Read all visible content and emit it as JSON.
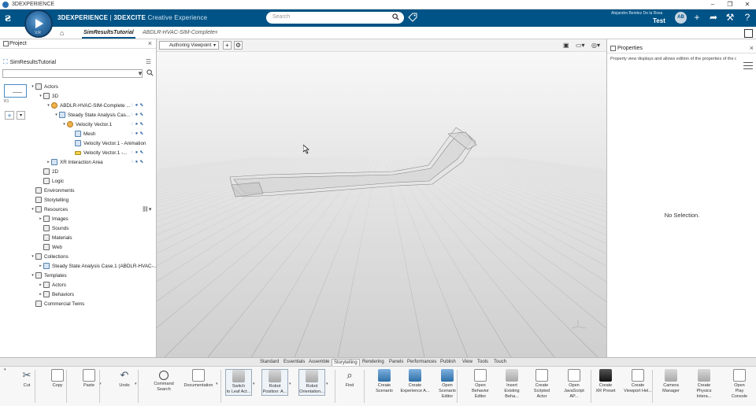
{
  "window": {
    "title": "3DEXPERIENCE",
    "controls": [
      "–",
      "❐",
      "✕"
    ]
  },
  "topbar": {
    "brand_bold": "3DEXPERIENCE",
    "brand_sep": " | ",
    "brand_app": "3DEXCITE",
    "brand_sub": " Creative Experience",
    "compass_version": "V.R",
    "search_placeholder": "Search",
    "user_name": "Alejandro Benitez De la Rosa",
    "tenant": "Test",
    "avatar_initials": "AB"
  },
  "tabs": {
    "active": "SimResultsTutorial",
    "inactive": "ABDLR-HVAC-SIM-Complete",
    "add": "+"
  },
  "left_panel": {
    "title": "Project",
    "project_name": "SimResultsTutorial",
    "thumb_label": "R1",
    "tree": [
      {
        "label": "Actors",
        "depth": 0,
        "toggle": "▾",
        "icon": "folder"
      },
      {
        "label": "3D",
        "depth": 1,
        "toggle": "▾",
        "icon": "folder"
      },
      {
        "label": "ABDLR-HVAC-SIM-Complete ...",
        "depth": 2,
        "toggle": "▾",
        "icon": "orange",
        "actions": true
      },
      {
        "label": "Steady State Analysis Cas...",
        "depth": 3,
        "toggle": "▾",
        "icon": "blue",
        "actions": true
      },
      {
        "label": "Velocity Vector.1",
        "depth": 4,
        "toggle": "▾",
        "icon": "orange",
        "actions": true
      },
      {
        "label": "Mesh",
        "depth": 5,
        "toggle": "",
        "icon": "blue",
        "actions": true
      },
      {
        "label": "Velocity Vector.1 - Animation",
        "depth": 5,
        "toggle": "",
        "icon": "blue",
        "actions": false
      },
      {
        "label": "Velocity Vector.1 -...",
        "depth": 5,
        "toggle": "",
        "icon": "yellow",
        "actions": true
      },
      {
        "label": "XR Interaction Area",
        "depth": 2,
        "toggle": "▸",
        "icon": "blue",
        "actions": true
      },
      {
        "label": "2D",
        "depth": 1,
        "toggle": "",
        "icon": "folder"
      },
      {
        "label": "Logic",
        "depth": 1,
        "toggle": "",
        "icon": "folder"
      },
      {
        "label": "Environments",
        "depth": 0,
        "toggle": "",
        "icon": "folder"
      },
      {
        "label": "Storytelling",
        "depth": 0,
        "toggle": "",
        "icon": "folder"
      },
      {
        "label": "Resources",
        "depth": 0,
        "toggle": "▾",
        "icon": "folder"
      },
      {
        "label": "Images",
        "depth": 1,
        "toggle": "▸",
        "icon": "folder"
      },
      {
        "label": "Sounds",
        "depth": 1,
        "toggle": "",
        "icon": "folder"
      },
      {
        "label": "Materials",
        "depth": 1,
        "toggle": "",
        "icon": "folder"
      },
      {
        "label": "Web",
        "depth": 1,
        "toggle": "",
        "icon": "folder"
      },
      {
        "label": "Collections",
        "depth": 0,
        "toggle": "▾",
        "icon": "folder"
      },
      {
        "label": "Steady State Analysis Case.1 (ABDLR-HVAC-...",
        "depth": 1,
        "toggle": "▸",
        "icon": "blue"
      },
      {
        "label": "Templates",
        "depth": 0,
        "toggle": "▾",
        "icon": "folder"
      },
      {
        "label": "Actors",
        "depth": 1,
        "toggle": "▸",
        "icon": "folder"
      },
      {
        "label": "Behaviors",
        "depth": 1,
        "toggle": "▸",
        "icon": "folder"
      },
      {
        "label": "Commercial Twins",
        "depth": 0,
        "toggle": "",
        "icon": "folder"
      }
    ]
  },
  "viewport": {
    "viewpoint_select": "Authoring Viewpoint"
  },
  "right_panel": {
    "title": "Properties",
    "description": "Property view displays and allows edition of the properties of the cu...",
    "empty_message": "No Selection."
  },
  "ribbon_tabs": [
    "Standard",
    "Essentials",
    "Assemble",
    "Storytelling",
    "Rendering",
    "Panels",
    "Performances",
    "Publish",
    "View",
    "Tools",
    "Touch"
  ],
  "ribbon_active_tab": "Storytelling",
  "ribbon_commands": [
    {
      "line1": "Cut",
      "line2": "",
      "icon": "scissors"
    },
    {
      "line1": "Copy",
      "line2": "",
      "icon": "doc"
    },
    {
      "line1": "Paste",
      "line2": "",
      "icon": "doc"
    },
    {
      "line1": "Undo",
      "line2": "",
      "icon": "undo"
    },
    {
      "line1": "Command",
      "line2": "Search",
      "icon": "cmd"
    },
    {
      "line1": "Documentation",
      "line2": "",
      "icon": "doc"
    },
    {
      "line1": "Switch",
      "line2": "to Leaf Act...",
      "icon": "gray"
    },
    {
      "line1": "Robot",
      "line2": "Position: A...",
      "icon": "gray"
    },
    {
      "line1": "Robot",
      "line2": "Orientation...",
      "icon": "gray"
    },
    {
      "line1": "Find",
      "line2": "",
      "icon": "find"
    },
    {
      "line1": "Create",
      "line2": "Scenario",
      "icon": "blue"
    },
    {
      "line1": "Create",
      "line2": "Experience A...",
      "icon": "blue"
    },
    {
      "line1": "Open",
      "line2": "Scenario Editor",
      "icon": "blue"
    },
    {
      "line1": "Open",
      "line2": "Behavior Editor",
      "icon": "doc"
    },
    {
      "line1": "Insert",
      "line2": "Existing Beha...",
      "icon": "gray"
    },
    {
      "line1": "Create",
      "line2": "Scripted Actor",
      "icon": "doc"
    },
    {
      "line1": "Open",
      "line2": "JavaScript AP...",
      "icon": "doc"
    },
    {
      "line1": "Create",
      "line2": "XR Preset",
      "icon": "dark"
    },
    {
      "line1": "Create",
      "line2": "Viewport Hel...",
      "icon": "doc"
    },
    {
      "line1": "Camera",
      "line2": "Manager",
      "icon": "gray"
    },
    {
      "line1": "Create",
      "line2": "Physics Intera...",
      "icon": "gray"
    },
    {
      "line1": "Open",
      "line2": "Play Console",
      "icon": "doc"
    }
  ]
}
